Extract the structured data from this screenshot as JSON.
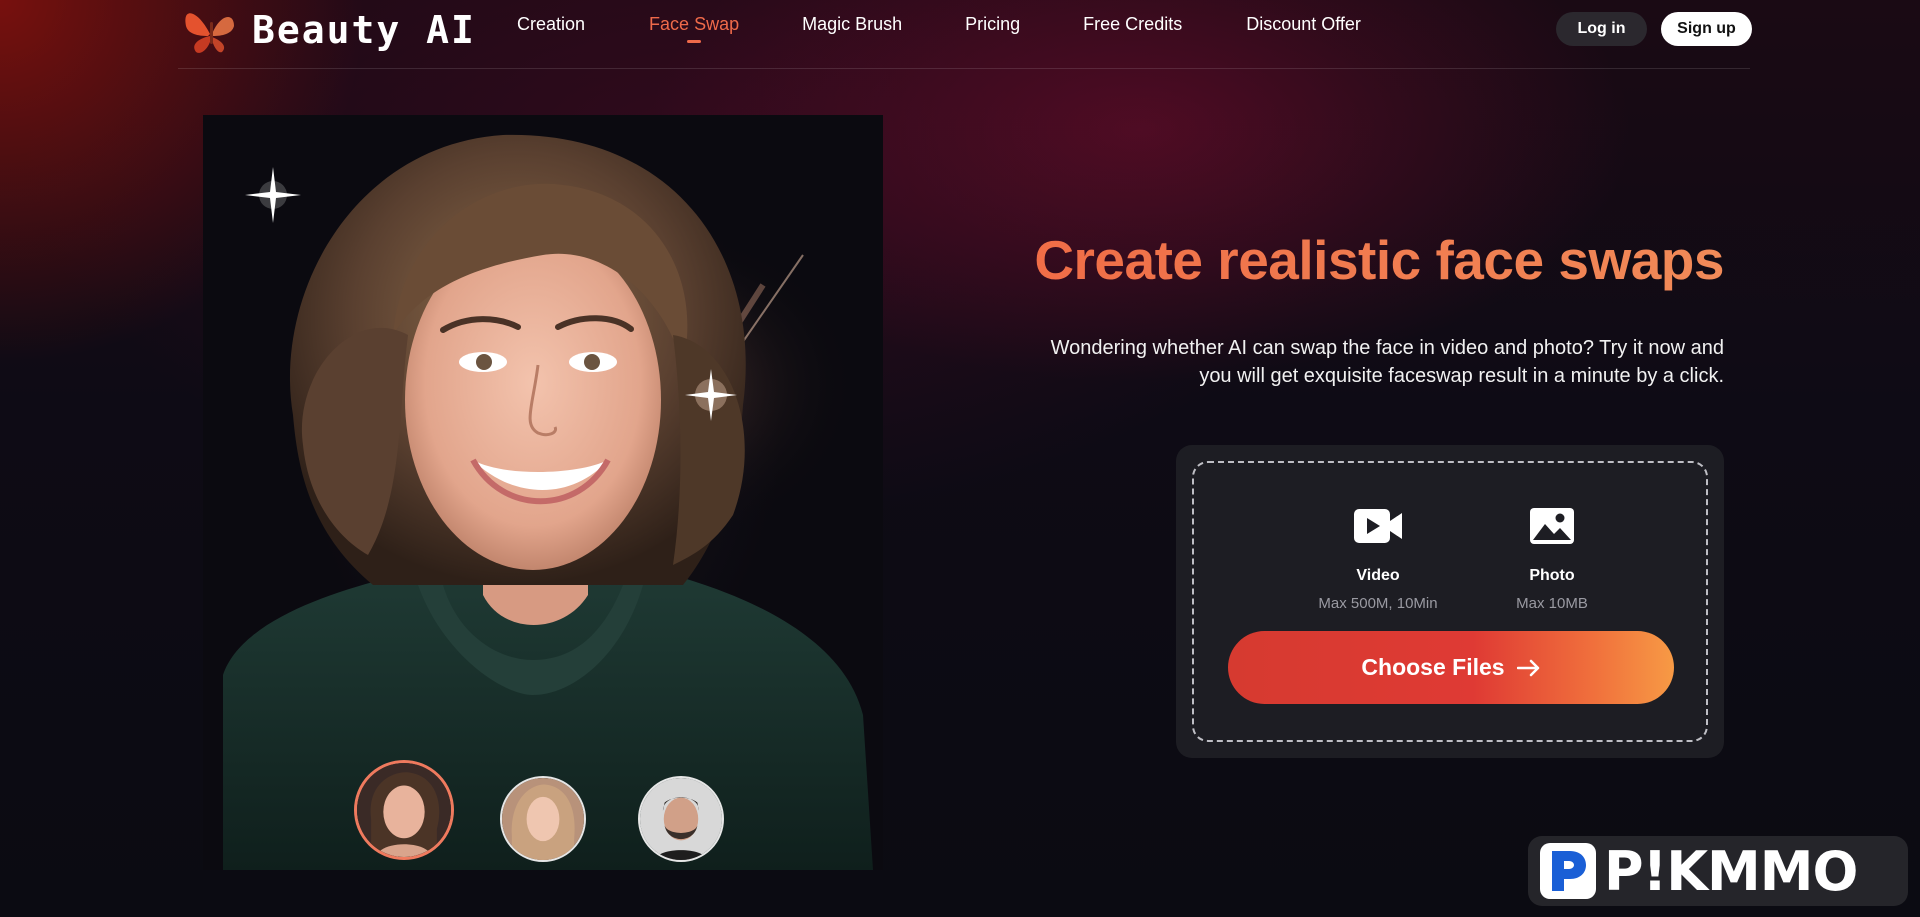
{
  "brand": {
    "name": "Beauty AI"
  },
  "nav": {
    "items": [
      {
        "label": "Creation",
        "active": false
      },
      {
        "label": "Face Swap",
        "active": true
      },
      {
        "label": "Magic Brush",
        "active": false
      },
      {
        "label": "Pricing",
        "active": false
      },
      {
        "label": "Free Credits",
        "active": false
      },
      {
        "label": "Discount Offer",
        "active": false
      }
    ],
    "login_label": "Log in",
    "signup_label": "Sign up"
  },
  "hero": {
    "headline": "Create realistic face swaps",
    "subtext_line1": "Wondering whether AI can swap the face in video and photo? Try it now and",
    "subtext_line2": "you will get exquisite faceswap result in a minute by a click.",
    "thumbnails": [
      {
        "selected": true
      },
      {
        "selected": false
      },
      {
        "selected": false
      }
    ]
  },
  "upload": {
    "video": {
      "label": "Video",
      "limit": "Max 500M, 10Min",
      "icon": "video-play-icon"
    },
    "photo": {
      "label": "Photo",
      "limit": "Max 10MB",
      "icon": "image-icon"
    },
    "button_label": "Choose Files",
    "button_icon": "arrow-right-icon"
  },
  "watermark": {
    "text": "P!KMMO",
    "icon": "p-logo-icon"
  },
  "colors": {
    "accent": "#ef6a4a",
    "button_gradient_start": "#d63a30",
    "button_gradient_end": "#f79a45",
    "card_bg": "#1d1d23"
  }
}
